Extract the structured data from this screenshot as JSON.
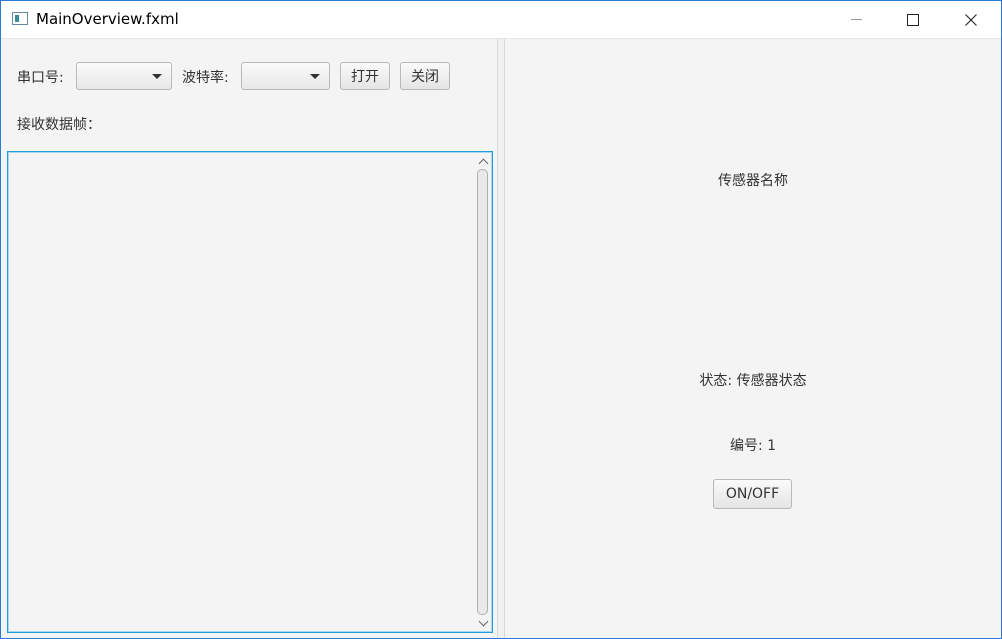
{
  "window": {
    "title": "MainOverview.fxml"
  },
  "serial": {
    "port_label": "串口号:",
    "port_value": "",
    "baud_label": "波特率:",
    "baud_value": "",
    "open_label": "打开",
    "close_label": "关闭",
    "receive_label": "接收数据帧："
  },
  "receive_area": {
    "value": ""
  },
  "sensor": {
    "name": "传感器名称",
    "status": "状态: 传感器状态",
    "number": "编号: 1",
    "toggle_label": "ON/OFF"
  },
  "icons": {
    "app": "app-window-icon",
    "minimize": "minimize-icon",
    "maximize": "maximize-icon",
    "close": "close-icon",
    "dropdown": "chevron-down-icon"
  },
  "colors": {
    "focus_border": "#1e9fd8",
    "window_border": "#2b7bd6"
  }
}
